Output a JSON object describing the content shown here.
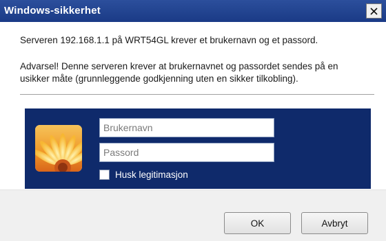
{
  "window": {
    "title": "Windows-sikkerhet",
    "close_icon": "close-icon"
  },
  "message": {
    "server": "Serveren 192.168.1.1 på WRT54GL krever et brukernavn og et passord.",
    "warning_line1": "Advarsel!  Denne serveren krever at brukernavnet og passordet sendes på en",
    "warning_line2": "usikker måte (grunnleggende godkjenning uten en sikker tilkobling)."
  },
  "credentials": {
    "avatar_icon": "user-tile-flower-icon",
    "username_placeholder": "Brukernavn",
    "username_value": "",
    "password_placeholder": "Passord",
    "password_value": "",
    "remember_label": "Husk legitimasjon",
    "remember_checked": false
  },
  "buttons": {
    "ok": "OK",
    "cancel": "Avbryt"
  },
  "colors": {
    "titlebar": "#1a3a86",
    "panel": "#0f2a6b",
    "button_bar": "#f0f0f0"
  }
}
